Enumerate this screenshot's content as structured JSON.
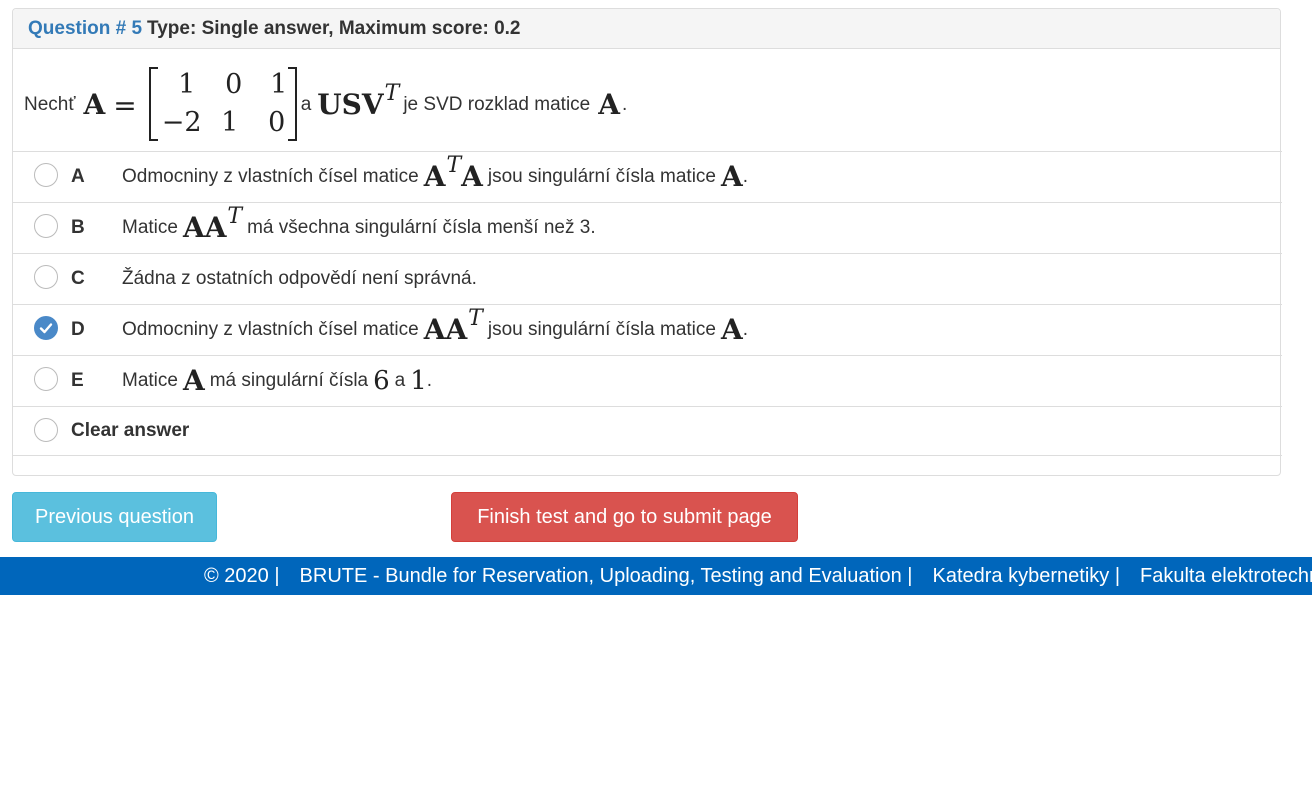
{
  "question": {
    "number_label": "Question # 5",
    "type_label": "Type: Single answer, Maximum score: 0.2"
  },
  "stem": {
    "intro": "Nechť",
    "matrix_symbol": "A",
    "equals": "=",
    "matrix": [
      [
        "1",
        "0",
        "1"
      ],
      [
        "−2",
        "1",
        "0"
      ]
    ],
    "connector": "a",
    "svd_symbol": "USV",
    "svd_sup": "T",
    "outro": "je SVD rozklad matice",
    "end_symbol": "A",
    "period": "."
  },
  "options": [
    {
      "letter": "A",
      "pre": "Odmocniny z vlastních čísel matice",
      "math1": "A",
      "sup": "T",
      "math2": "A",
      "post": "jsou singulární čísla matice",
      "math3": "A",
      "end": ".",
      "checked": false
    },
    {
      "letter": "B",
      "pre": "Matice",
      "math1": "AA",
      "sup": "T",
      "post": "má všechna singulární čísla menší než 3.",
      "checked": false
    },
    {
      "letter": "C",
      "pre": "Žádna z ostatních odpovědí není správná.",
      "checked": false
    },
    {
      "letter": "D",
      "pre": "Odmocniny z vlastních čísel matice",
      "math1": "AA",
      "sup": "T",
      "post": "jsou singulární čísla matice",
      "math3": "A",
      "end": ".",
      "checked": true
    },
    {
      "letter": "E",
      "pre": "Matice",
      "math1": "A",
      "post": "má singulární čísla",
      "n1": "6",
      "mid": "a",
      "n2": "1",
      "end": ".",
      "checked": false
    }
  ],
  "clear_label": "Clear answer",
  "buttons": {
    "previous": "Previous question",
    "finish": "Finish test and go to submit page"
  },
  "footer": {
    "copyright": "© 2020 |",
    "brute": "BRUTE - Bundle for Reservation, Uploading, Testing and Evaluation |",
    "katedra": "Katedra kybernetiky |",
    "fakulta": "Fakulta elektrotechnická"
  },
  "colors": {
    "accent_blue": "#337ab7",
    "info_button": "#5bc0de",
    "danger_button": "#d9534f",
    "footer_bg": "#0066bb",
    "checked_radio": "#4a89c8"
  }
}
